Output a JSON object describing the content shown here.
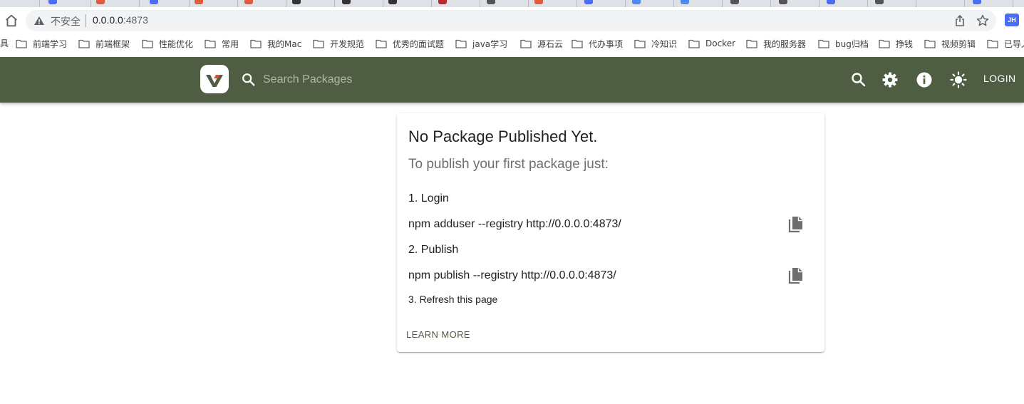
{
  "browser": {
    "security_label": "不安全",
    "url_host": "0.0.0.0",
    "url_port": ":4873",
    "profile_initials": "JH",
    "bookmarks_first": "具",
    "bookmarks": [
      "前端学习",
      "前端框架",
      "性能优化",
      "常用",
      "我的Mac",
      "开发规范",
      "优秀的面试题",
      "java学习",
      "源石云",
      "代办事项",
      "冷知识",
      "Docker",
      "我的服务器",
      "bug归档",
      "挣钱",
      "视频剪辑",
      "已导入"
    ]
  },
  "appbar": {
    "search_placeholder": "Search Packages",
    "login_label": "LOGIN",
    "bg_color": "#4f5e42"
  },
  "card": {
    "title": "No Package Published Yet.",
    "subtitle": "To publish your first package just:",
    "step1": "1. Login",
    "cmd1": "npm adduser --registry http://0.0.0.0:4873/",
    "step2": "2. Publish",
    "cmd2": "npm publish --registry http://0.0.0.0:4873/",
    "step3": "3. Refresh this page",
    "learn_more": "LEARN MORE"
  }
}
